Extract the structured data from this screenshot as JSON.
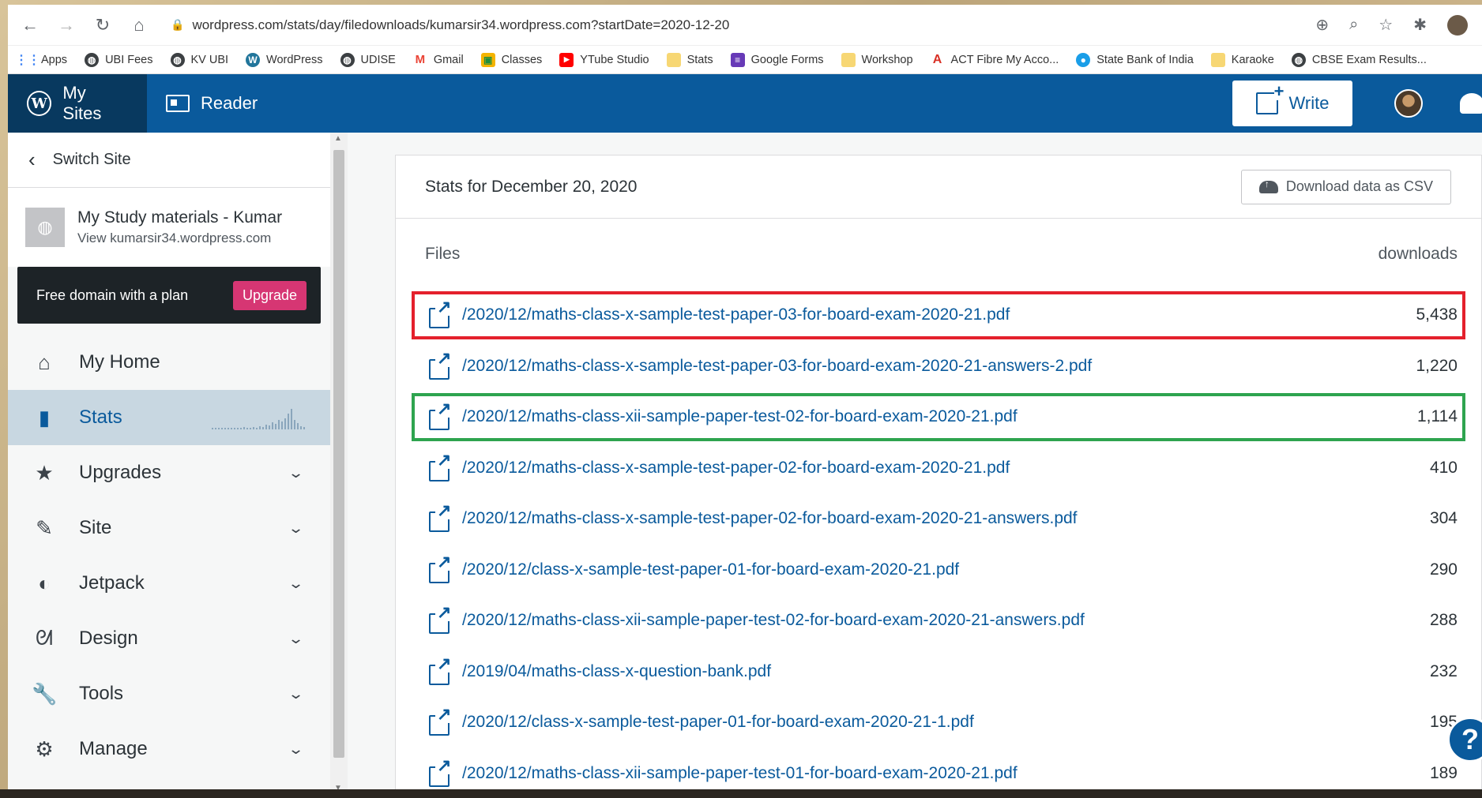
{
  "browser": {
    "url": "wordpress.com/stats/day/filedownloads/kumarsir34.wordpress.com?startDate=2020-12-20",
    "bookmarks": [
      {
        "label": "Apps",
        "icon": "apps-grid-icon"
      },
      {
        "label": "UBI Fees",
        "icon": "globe-icon"
      },
      {
        "label": "KV UBI",
        "icon": "globe-icon"
      },
      {
        "label": "WordPress",
        "icon": "wordpress-icon"
      },
      {
        "label": "UDISE",
        "icon": "globe-icon"
      },
      {
        "label": "Gmail",
        "icon": "gmail-icon"
      },
      {
        "label": "Classes",
        "icon": "classroom-icon"
      },
      {
        "label": "YTube Studio",
        "icon": "youtube-icon"
      },
      {
        "label": "Stats",
        "icon": "folder-icon"
      },
      {
        "label": "Google Forms",
        "icon": "forms-icon"
      },
      {
        "label": "Workshop",
        "icon": "folder-icon"
      },
      {
        "label": "ACT Fibre My Acco...",
        "icon": "act-icon"
      },
      {
        "label": "State Bank of India",
        "icon": "sbi-icon"
      },
      {
        "label": "Karaoke",
        "icon": "folder-icon"
      },
      {
        "label": "CBSE Exam Results...",
        "icon": "globe-icon"
      }
    ]
  },
  "masterbar": {
    "my_sites": "My Sites",
    "reader": "Reader",
    "write": "Write"
  },
  "sidebar": {
    "switch_site": "Switch Site",
    "site_name": "My Study materials - Kumar",
    "site_url": "View kumarsir34.wordpress.com",
    "upsell_text": "Free domain with a plan",
    "upgrade_label": "Upgrade",
    "items": [
      {
        "label": "My Home",
        "icon": "home-icon",
        "chevron": false
      },
      {
        "label": "Stats",
        "icon": "stats-bars-icon",
        "chevron": false,
        "active": true
      },
      {
        "label": "Upgrades",
        "icon": "star-icon",
        "chevron": true
      },
      {
        "label": "Site",
        "icon": "pencil-icon",
        "chevron": true
      },
      {
        "label": "Jetpack",
        "icon": "jetpack-icon",
        "chevron": true
      },
      {
        "label": "Design",
        "icon": "design-icon",
        "chevron": true
      },
      {
        "label": "Tools",
        "icon": "wrench-icon",
        "chevron": true
      },
      {
        "label": "Manage",
        "icon": "gear-icon",
        "chevron": true
      }
    ]
  },
  "main": {
    "title": "Stats for December 20, 2020",
    "csv_label": "Download data as CSV",
    "files_header": "Files",
    "downloads_header": "downloads",
    "files": [
      {
        "path": "/2020/12/maths-class-x-sample-test-paper-03-for-board-exam-2020-21.pdf",
        "downloads": "5,438",
        "highlight": "red"
      },
      {
        "path": "/2020/12/maths-class-x-sample-test-paper-03-for-board-exam-2020-21-answers-2.pdf",
        "downloads": "1,220",
        "highlight": ""
      },
      {
        "path": "/2020/12/maths-class-xii-sample-paper-test-02-for-board-exam-2020-21.pdf",
        "downloads": "1,114",
        "highlight": "green"
      },
      {
        "path": "/2020/12/maths-class-x-sample-test-paper-02-for-board-exam-2020-21.pdf",
        "downloads": "410",
        "highlight": ""
      },
      {
        "path": "/2020/12/maths-class-x-sample-test-paper-02-for-board-exam-2020-21-answers.pdf",
        "downloads": "304",
        "highlight": ""
      },
      {
        "path": "/2020/12/class-x-sample-test-paper-01-for-board-exam-2020-21.pdf",
        "downloads": "290",
        "highlight": ""
      },
      {
        "path": "/2020/12/maths-class-xii-sample-paper-test-02-for-board-exam-2020-21-answers.pdf",
        "downloads": "288",
        "highlight": ""
      },
      {
        "path": "/2019/04/maths-class-x-question-bank.pdf",
        "downloads": "232",
        "highlight": ""
      },
      {
        "path": "/2020/12/class-x-sample-test-paper-01-for-board-exam-2020-21-1.pdf",
        "downloads": "195",
        "highlight": ""
      },
      {
        "path": "/2020/12/maths-class-xii-sample-paper-test-01-for-board-exam-2020-21.pdf",
        "downloads": "189",
        "highlight": ""
      }
    ]
  },
  "help_label": "?",
  "colors": {
    "masterbar": "#0a5a9c",
    "link": "#0a5a9c",
    "upgrade": "#d63673",
    "highlight_red": "#e4202c",
    "highlight_green": "#2ea44f"
  }
}
